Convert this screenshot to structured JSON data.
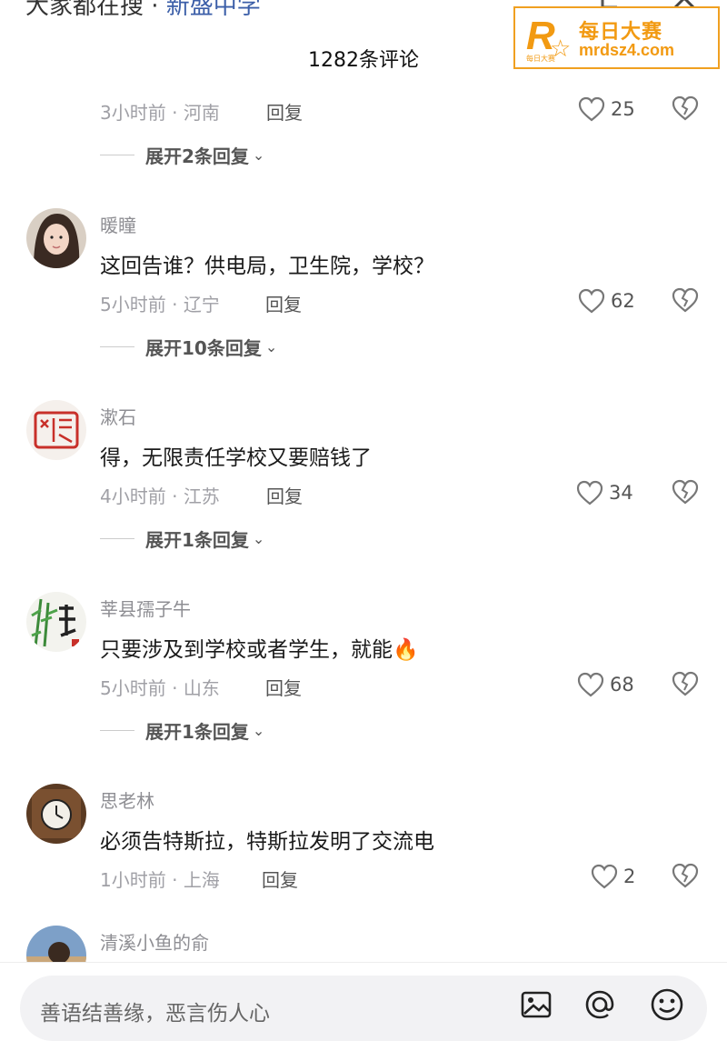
{
  "header": {
    "title_prefix": "大家都在搜 · ",
    "title_link": "新盛中学",
    "comment_count": "1282条评论"
  },
  "watermark": {
    "letter": "R",
    "small": "每日大赛",
    "name_cn": "每日大赛",
    "url": "mrdsz4.com",
    "color": "#f29a12"
  },
  "comments": [
    {
      "time": "3小时前",
      "location": "河南",
      "reply_label": "回复",
      "likes": "25",
      "expand": "展开2条回复"
    },
    {
      "user": "暖瞳",
      "text": "这回告谁？供电局，卫生院，学校？",
      "time": "5小时前",
      "location": "辽宁",
      "reply_label": "回复",
      "likes": "62",
      "expand": "展开10条回复",
      "avatar": "woman-portrait"
    },
    {
      "user": "漱石",
      "text": "得，无限责任学校又要赔钱了",
      "time": "4小时前",
      "location": "江苏",
      "reply_label": "回复",
      "likes": "34",
      "expand": "展开1条回复",
      "avatar": "red-seal"
    },
    {
      "user": "莘县孺子牛",
      "text": "只要涉及到学校或者学生，就能",
      "emoji": "🔥",
      "time": "5小时前",
      "location": "山东",
      "reply_label": "回复",
      "likes": "68",
      "expand": "展开1条回复",
      "avatar": "bamboo-calligraphy"
    },
    {
      "user": "思老林",
      "text": "必须告特斯拉，特斯拉发明了交流电",
      "time": "1小时前",
      "location": "上海",
      "reply_label": "回复",
      "likes": "2",
      "avatar": "clock"
    },
    {
      "user": "清溪小鱼的俞",
      "avatar": "person-outdoor"
    }
  ],
  "input": {
    "placeholder": "善语结善缘，恶言伤人心"
  },
  "icons": {
    "image": "image-icon",
    "mention": "at-icon",
    "emoji": "emoji-icon"
  }
}
